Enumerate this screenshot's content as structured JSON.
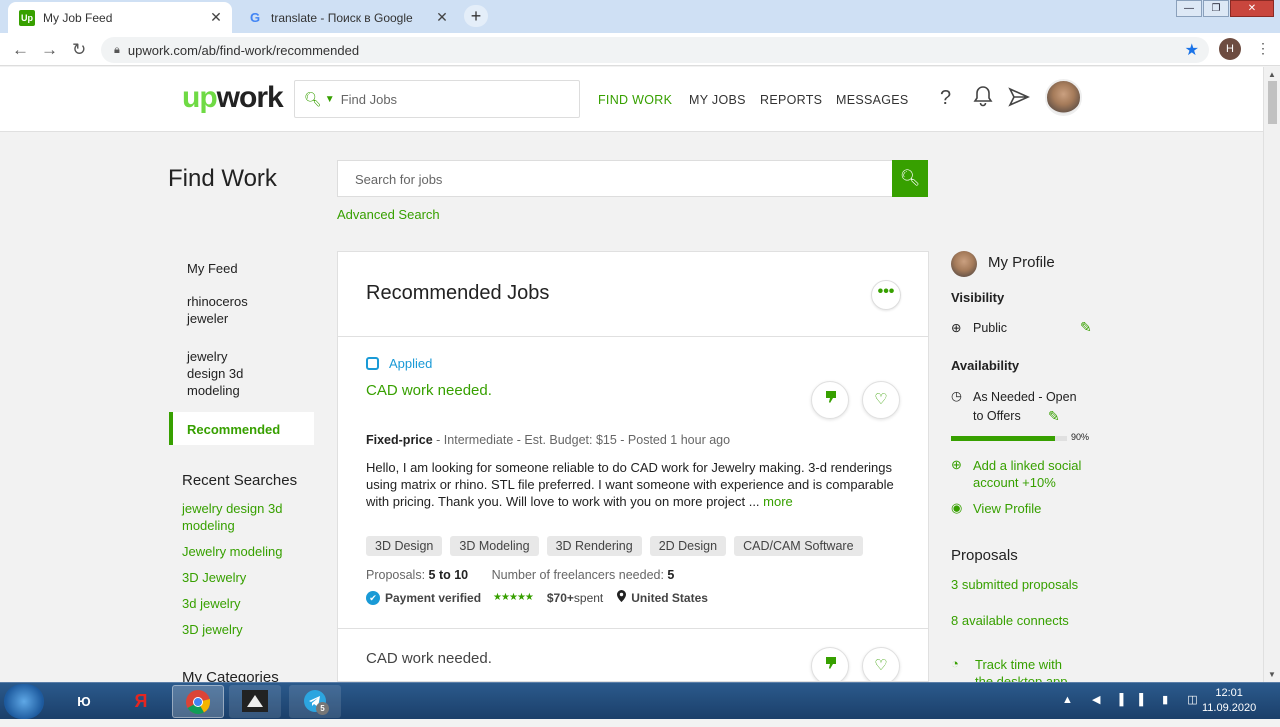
{
  "browser": {
    "tabs": [
      {
        "title": "My Job Feed",
        "active": true
      },
      {
        "title": "translate - Поиск в Google",
        "active": false
      }
    ],
    "url": "upwork.com/ab/find-work/recommended",
    "profile_initial": "H"
  },
  "header": {
    "logo_up": "up",
    "logo_work": "work",
    "search_placeholder": "Find Jobs",
    "nav": [
      "FIND WORK",
      "MY JOBS",
      "REPORTS",
      "MESSAGES"
    ],
    "help": "?"
  },
  "page": {
    "title": "Find Work",
    "search_placeholder": "Search for jobs",
    "advanced_search": "Advanced Search"
  },
  "left_nav": {
    "items": [
      "My Feed",
      "rhinoceros jeweler",
      "jewelry design 3d modeling",
      "Recommended"
    ],
    "recent_heading": "Recent Searches",
    "recent": [
      "jewelry design 3d modeling",
      "Jewelry modeling",
      "3D Jewelry",
      "3d jewelry",
      "3D jewelry"
    ],
    "categories_heading": "My Categories"
  },
  "main": {
    "heading": "Recommended Jobs",
    "more": "•••",
    "jobs": [
      {
        "status": "Applied",
        "title": "CAD work needed.",
        "type": "Fixed-price",
        "meta": " - Intermediate - Est. Budget: $15 - Posted 1 hour ago",
        "description": "Hello, I am looking for someone reliable to do CAD work for Jewelry making. 3-d renderings using matrix or rhino. STL file preferred. I want someone with experience and is comparable with pricing. Thank you. Will love to work with you on more project",
        "ellipsis": " ... ",
        "more": "more",
        "skills": [
          "3D Design",
          "3D Modeling",
          "3D Rendering",
          "2D Design",
          "CAD/CAM Software"
        ],
        "proposals_label": "Proposals: ",
        "proposals": "5 to 10",
        "freelancers_label": "Number of freelancers needed: ",
        "freelancers": "5",
        "payment": "Payment verified",
        "stars": "★★★★★",
        "spent": "$70+",
        "spent_label": " spent",
        "location": "United States"
      },
      {
        "title": "CAD work needed."
      }
    ]
  },
  "sidebar": {
    "profile": "My Profile",
    "visibility_heading": "Visibility",
    "visibility": "Public",
    "availability_heading": "Availability",
    "availability_line1": "As Needed - Open",
    "availability_line2": "to Offers",
    "completeness": 0.9,
    "completeness_label": "90%",
    "add_social_1": "Add a linked social",
    "add_social_2": "account +10%",
    "view_profile": "View Profile",
    "proposals_heading": "Proposals",
    "submitted": "3 submitted proposals",
    "connects": "8 available connects",
    "track_1": "Track time with",
    "track_2": "the desktop app"
  },
  "taskbar": {
    "time": "12:01",
    "date": "11.09.2020",
    "telegram_badge": "5"
  },
  "colors": {
    "brand": "#37a000",
    "logo": "#6fda44",
    "applied": "#1a9ad6"
  }
}
